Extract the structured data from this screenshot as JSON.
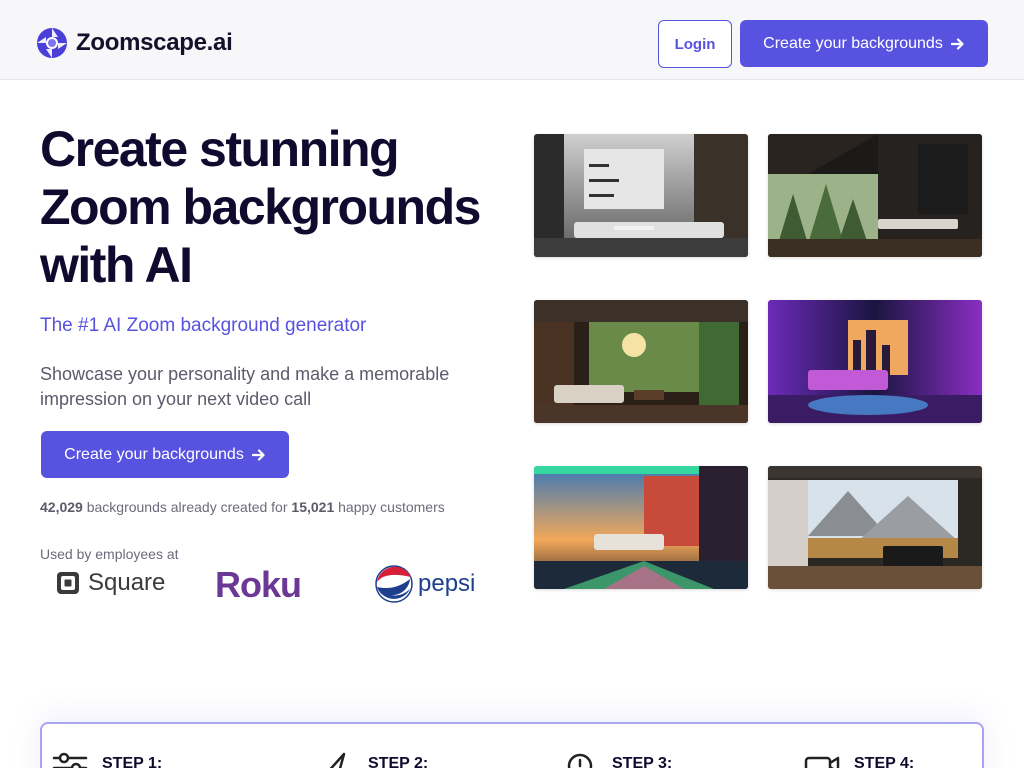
{
  "header": {
    "brand": "Zoomscape.ai",
    "login_label": "Login",
    "cta_label": "Create your backgrounds"
  },
  "hero": {
    "title_lines": [
      "Create stunning",
      "Zoom backgrounds",
      "with AI"
    ],
    "subtitle": "The #1 AI Zoom background generator",
    "description": "Showcase your personality and make a memorable impression on your next video call",
    "cta_label": "Create your backgrounds",
    "stats": {
      "backgrounds_count": "42,029",
      "backgrounds_text": "backgrounds already created for",
      "customers_count": "15,021",
      "customers_text": "happy customers"
    },
    "used_by_label": "Used by employees at",
    "brands": {
      "square": "Square",
      "roku": "Roku",
      "pepsi": "pepsi"
    }
  },
  "gallery": [
    {
      "icon": "modern-living-room-image"
    },
    {
      "icon": "forest-cabin-living-room-image"
    },
    {
      "icon": "jungle-view-living-room-image"
    },
    {
      "icon": "neon-city-bedroom-image"
    },
    {
      "icon": "neon-sunset-bedroom-image"
    },
    {
      "icon": "mountain-view-lounge-image"
    }
  ],
  "steps": [
    {
      "label": "STEP 1:",
      "icon": "sliders-icon"
    },
    {
      "label": "STEP 2:",
      "icon": "paper-plane-icon"
    },
    {
      "label": "STEP 3:",
      "icon": "clock-download-icon"
    },
    {
      "label": "STEP 4:",
      "icon": "video-camera-icon"
    }
  ],
  "colors": {
    "accent": "#5752e0",
    "heading": "#0f0a2e",
    "body_text": "#5b5b6b",
    "roku": "#6c3896",
    "pepsi_blue": "#1e3f8e",
    "pepsi_red": "#d6203a"
  }
}
